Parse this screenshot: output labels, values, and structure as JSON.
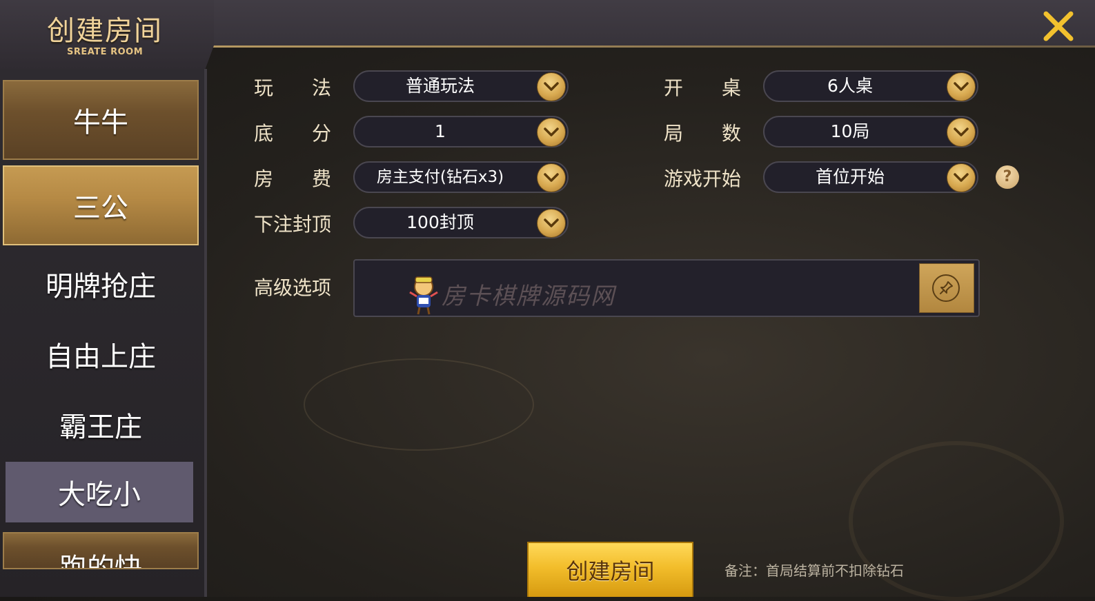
{
  "header": {
    "title": "创建房间",
    "subtitle": "SREATE ROOM",
    "close_icon": "close-icon"
  },
  "sidebar": {
    "items": [
      {
        "label": "牛牛",
        "style": "wood"
      },
      {
        "label": "三公",
        "style": "gold",
        "selected": true
      },
      {
        "label": "明牌抢庄",
        "style": "plain"
      },
      {
        "label": "自由上庄",
        "style": "plain"
      },
      {
        "label": "霸王庄",
        "style": "plain"
      },
      {
        "label": "大吃小",
        "style": "purple"
      },
      {
        "label": "跑的快",
        "style": "wood",
        "partially_visible": true
      }
    ]
  },
  "form": {
    "play_mode": {
      "label": "玩　　法",
      "value": "普通玩法"
    },
    "base_score": {
      "label": "底　　分",
      "value": "1"
    },
    "room_fee": {
      "label": "房　　费",
      "value": "房主支付(钻石x3)"
    },
    "bet_cap": {
      "label": "下注封顶",
      "value": "100封顶"
    },
    "table_size": {
      "label": "开　　桌",
      "value": "6人桌"
    },
    "rounds": {
      "label": "局　　数",
      "value": "10局"
    },
    "game_start": {
      "label": "游戏开始",
      "value": "首位开始"
    },
    "advanced": {
      "label": "高级选项",
      "watermark": "房卡棋牌源码网"
    }
  },
  "actions": {
    "create_label": "创建房间",
    "note": "备注：首局结算前不扣除钻石"
  },
  "colors": {
    "gold_accent": "#d7a84f",
    "button_yellow": "#f2bd2b",
    "label_text": "#efe3c8"
  }
}
